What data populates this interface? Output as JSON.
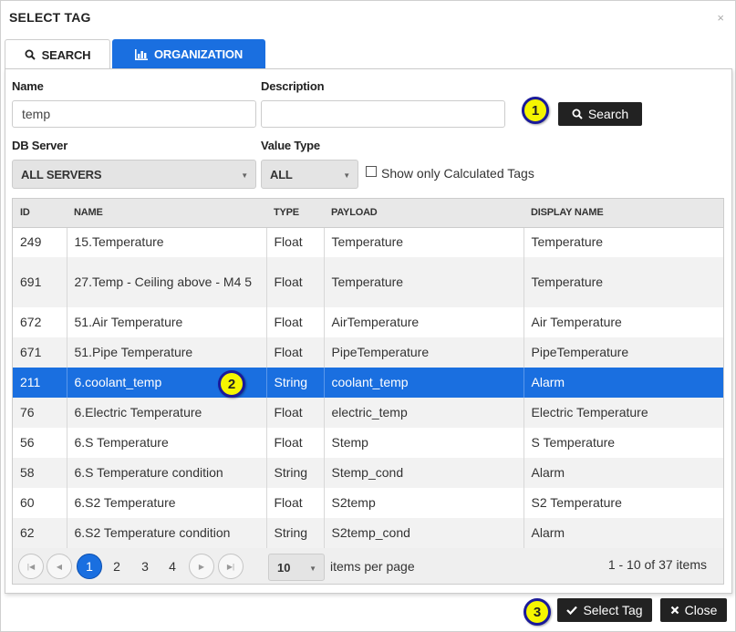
{
  "dialog": {
    "title": "SELECT TAG",
    "close_glyph": "×"
  },
  "tabs": [
    {
      "label": "SEARCH",
      "icon": "search-icon"
    },
    {
      "label": "ORGANIZATION",
      "icon": "bar-chart-icon"
    }
  ],
  "form": {
    "name_label": "Name",
    "name_value": "temp",
    "description_label": "Description",
    "description_value": "",
    "search_button": "Search",
    "db_server_label": "DB Server",
    "db_server_value": "ALL SERVERS",
    "value_type_label": "Value Type",
    "value_type_value": "ALL",
    "calc_checkbox_label": "Show only Calculated Tags",
    "calc_checked": false
  },
  "callouts": [
    "1",
    "2",
    "3"
  ],
  "grid": {
    "columns": [
      "ID",
      "NAME",
      "TYPE",
      "PAYLOAD",
      "DISPLAY NAME"
    ],
    "rows": [
      {
        "id": "249",
        "name": "15.Temperature",
        "type": "Float",
        "payload": "Temperature",
        "display": "Temperature"
      },
      {
        "id": "691",
        "name": "27.Temp - Ceiling above - M4 5",
        "type": "Float",
        "payload": "Temperature",
        "display": "Temperature"
      },
      {
        "id": "672",
        "name": "51.Air Temperature",
        "type": "Float",
        "payload": "AirTemperature",
        "display": "Air Temperature"
      },
      {
        "id": "671",
        "name": "51.Pipe Temperature",
        "type": "Float",
        "payload": "PipeTemperature",
        "display": "PipeTemperature"
      },
      {
        "id": "211",
        "name": "6.coolant_temp",
        "type": "String",
        "payload": "coolant_temp",
        "display": "Alarm"
      },
      {
        "id": "76",
        "name": "6.Electric Temperature",
        "type": "Float",
        "payload": "electric_temp",
        "display": "Electric Temperature"
      },
      {
        "id": "56",
        "name": "6.S Temperature",
        "type": "Float",
        "payload": "Stemp",
        "display": "S Temperature"
      },
      {
        "id": "58",
        "name": "6.S Temperature condition",
        "type": "String",
        "payload": "Stemp_cond",
        "display": "Alarm"
      },
      {
        "id": "60",
        "name": "6.S2 Temperature",
        "type": "Float",
        "payload": "S2temp",
        "display": "S2 Temperature"
      },
      {
        "id": "62",
        "name": "6.S2 Temperature condition",
        "type": "String",
        "payload": "S2temp_cond",
        "display": "Alarm"
      }
    ],
    "selected_id": "211"
  },
  "pager": {
    "pages": [
      "1",
      "2",
      "3",
      "4"
    ],
    "current": "1",
    "page_size": "10",
    "per_page_label": "items per page",
    "summary": "1 - 10 of 37 items"
  },
  "footer": {
    "select_button": "Select Tag",
    "close_button": "Close"
  },
  "colors": {
    "accent": "#1a6fe0",
    "callout_fill": "#f5f500",
    "callout_ring": "#1a1a9a",
    "button_dark": "#222222"
  }
}
